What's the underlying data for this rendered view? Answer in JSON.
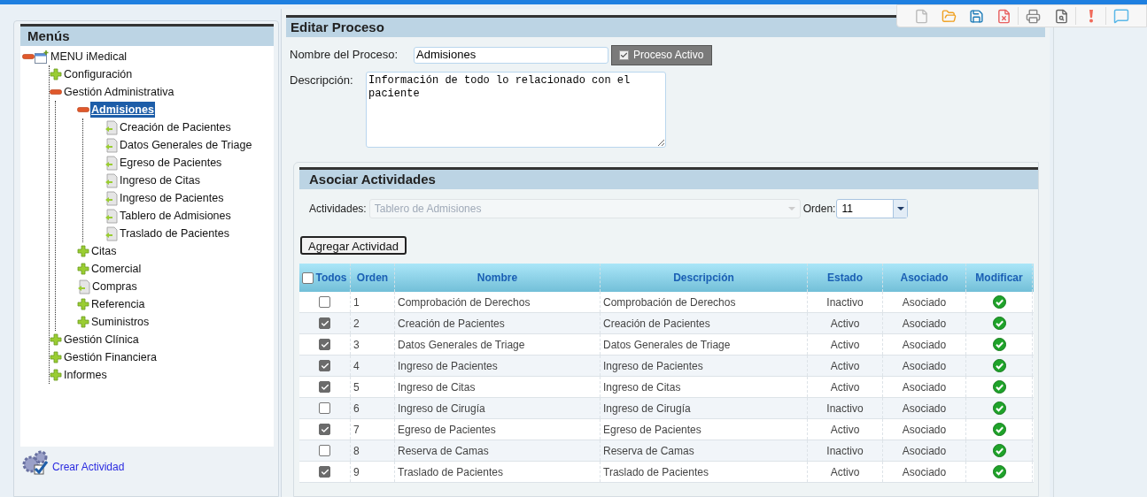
{
  "menu": {
    "title": "Menús",
    "tree": [
      {
        "label": "MENU iMedical",
        "kind": "root",
        "expanded": true,
        "selected": false,
        "children": [
          {
            "label": "Configuración",
            "kind": "folder",
            "expanded": false,
            "selected": false
          },
          {
            "label": "Gestión Administrativa",
            "kind": "folder",
            "expanded": true,
            "selected": false,
            "children": [
              {
                "label": "Admisiones",
                "kind": "folder",
                "expanded": true,
                "selected": true,
                "children": [
                  {
                    "label": "Creación de Pacientes",
                    "kind": "page",
                    "selected": false
                  },
                  {
                    "label": "Datos Generales de Triage",
                    "kind": "page",
                    "selected": false
                  },
                  {
                    "label": "Egreso de Pacientes",
                    "kind": "page",
                    "selected": false
                  },
                  {
                    "label": "Ingreso de Citas",
                    "kind": "page",
                    "selected": false
                  },
                  {
                    "label": "Ingreso de Pacientes",
                    "kind": "page",
                    "selected": false
                  },
                  {
                    "label": "Tablero de Admisiones",
                    "kind": "page",
                    "selected": false
                  },
                  {
                    "label": "Traslado de Pacientes",
                    "kind": "page",
                    "selected": false
                  }
                ]
              },
              {
                "label": "Citas",
                "kind": "folder",
                "expanded": false,
                "selected": false
              },
              {
                "label": "Comercial",
                "kind": "folder",
                "expanded": false,
                "selected": false
              },
              {
                "label": "Compras",
                "kind": "page",
                "selected": false
              },
              {
                "label": "Referencia",
                "kind": "folder",
                "expanded": false,
                "selected": false
              },
              {
                "label": "Suministros",
                "kind": "folder",
                "expanded": false,
                "selected": false
              }
            ]
          },
          {
            "label": "Gestión Clínica",
            "kind": "folder",
            "expanded": false,
            "selected": false
          },
          {
            "label": "Gestión Financiera",
            "kind": "folder",
            "expanded": false,
            "selected": false
          },
          {
            "label": "Informes",
            "kind": "folder",
            "expanded": false,
            "selected": false
          }
        ]
      }
    ],
    "footer_link": "Crear Actividad"
  },
  "editor": {
    "title": "Editar Proceso",
    "name_label": "Nombre del Proceso:",
    "name_value": "Admisiones",
    "active_toggle": {
      "label": "Proceso Activo",
      "checked": true
    },
    "description_label": "Descripción:",
    "description_value": "Información de todo lo relacionado con el paciente"
  },
  "activities": {
    "title": "Asociar Actividades",
    "activity_label": "Actividades:",
    "activity_value": "Tablero de Admisiones",
    "order_label": "Orden:",
    "order_value": "11",
    "add_button": "Agregar Actividad",
    "table": {
      "select_all": {
        "label": "Todos",
        "checked": false
      },
      "columns": [
        "Orden",
        "Nombre",
        "Descripción",
        "Estado",
        "Asociado",
        "Modificar"
      ],
      "rows": [
        {
          "checked": false,
          "order": "1",
          "name": "Comprobación de Derechos",
          "description": "Comprobación de Derechos",
          "status": "Inactivo",
          "associated": "Asociado"
        },
        {
          "checked": true,
          "order": "2",
          "name": "Creación de Pacientes",
          "description": "Creación de Pacientes",
          "status": "Activo",
          "associated": "Asociado"
        },
        {
          "checked": true,
          "order": "3",
          "name": "Datos Generales de Triage",
          "description": "Datos Generales de Triage",
          "status": "Activo",
          "associated": "Asociado"
        },
        {
          "checked": true,
          "order": "4",
          "name": "Ingreso de Pacientes",
          "description": "Ingreso de Pacientes",
          "status": "Activo",
          "associated": "Asociado"
        },
        {
          "checked": true,
          "order": "5",
          "name": "Ingreso de Citas",
          "description": "Ingreso de Citas",
          "status": "Activo",
          "associated": "Asociado"
        },
        {
          "checked": false,
          "order": "6",
          "name": "Ingreso de Cirugía",
          "description": "Ingreso de Cirugía",
          "status": "Inactivo",
          "associated": "Asociado"
        },
        {
          "checked": true,
          "order": "7",
          "name": "Egreso de Pacientes",
          "description": "Egreso de Pacientes",
          "status": "Activo",
          "associated": "Asociado"
        },
        {
          "checked": false,
          "order": "8",
          "name": "Reserva de Camas",
          "description": "Reserva de Camas",
          "status": "Inactivo",
          "associated": "Asociado"
        },
        {
          "checked": true,
          "order": "9",
          "name": "Traslado de Pacientes",
          "description": "Traslado de Pacientes",
          "status": "Activo",
          "associated": "Asociado"
        }
      ]
    }
  }
}
